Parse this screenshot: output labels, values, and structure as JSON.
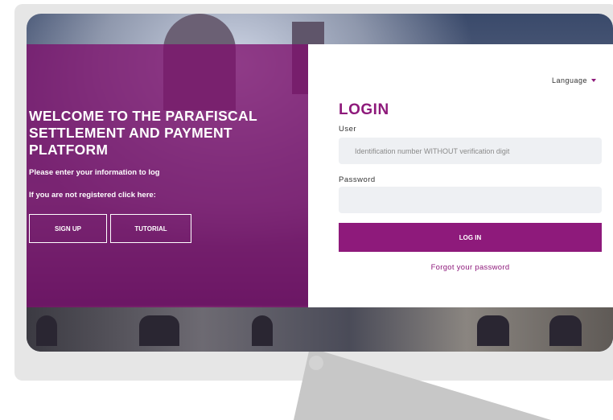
{
  "welcome": {
    "title": "WELCOME TO THE PARAFISCAL SETTLEMENT AND PAYMENT PLATFORM",
    "info_text": "Please enter your information to log",
    "register_text": "If you are not registered click here:",
    "signup_label": "SIGN UP",
    "tutorial_label": "TUTORIAL"
  },
  "login": {
    "language_label": "Language",
    "title": "LOGIN",
    "user_label": "User",
    "user_placeholder": "Identification number WITHOUT verification digit",
    "password_label": "Password",
    "password_value": "",
    "login_button": "LOG IN",
    "forgot_link": "Forgot your password"
  },
  "colors": {
    "brand": "#8e1a7b",
    "overlay": "rgba(125,16,109,0.78)"
  },
  "icons": {
    "language_caret": "caret-down-icon"
  }
}
